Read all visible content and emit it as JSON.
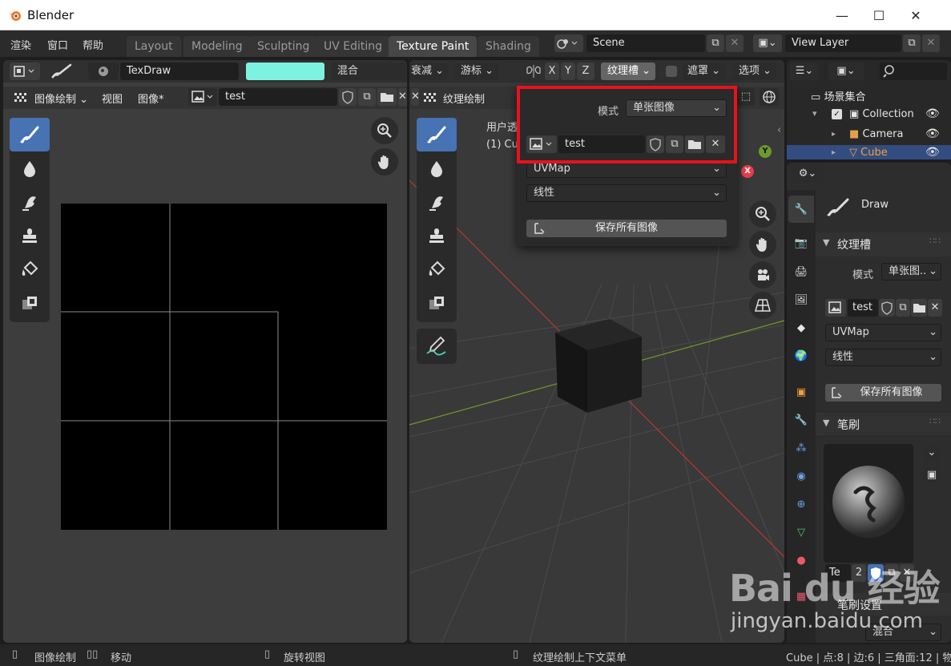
{
  "window": {
    "title": "Blender",
    "minimize": "—",
    "maximize": "☐",
    "close": "✕"
  },
  "menu": [
    "渲染",
    "窗口",
    "帮助"
  ],
  "workspace_tabs": [
    "Layout",
    "Modeling",
    "Sculpting",
    "UV Editing",
    "Texture Paint",
    "Shading"
  ],
  "active_tab": "Texture Paint",
  "scene": {
    "name": "Scene",
    "view_layer": "View Layer"
  },
  "left_editor": {
    "brush_name": "TexDraw",
    "blend_mode": "混合",
    "editor_mode": "图像绘制",
    "menu_view": "视图",
    "menu_image": "图像*",
    "image_name": "test",
    "brush_color": "#7ef2e0"
  },
  "viewport": {
    "falloff": "衰减",
    "cursor": "游标",
    "axis_x": "X",
    "axis_y": "Y",
    "axis_z": "Z",
    "texture_slots": "纹理槽",
    "mask": "遮罩",
    "options": "选项",
    "mode": "纹理绘制",
    "overlay_line1": "用户透",
    "overlay_line2": "(1) Cu",
    "gizmo_x": "X",
    "gizmo_y": "Y"
  },
  "popup": {
    "mode_label": "模式",
    "mode_value": "单张图像",
    "image_name": "test",
    "uvmap": "UVMap",
    "interpolation": "线性",
    "save_all": "保存所有图像"
  },
  "outliner": {
    "scene_collection": "场景集合",
    "items": [
      {
        "name": "Collection"
      },
      {
        "name": "Camera"
      },
      {
        "name": "Cube"
      }
    ]
  },
  "properties": {
    "tool_name": "Draw",
    "section_texture_slots": "纹理槽",
    "mode_label": "模式",
    "mode_value": "单张图..",
    "image_name": "test",
    "uvmap": "UVMap",
    "interpolation": "线性",
    "save_all": "保存所有图像",
    "section_brush": "笔刷",
    "brush_field": "Te",
    "brush_users": "2",
    "section_brush_settings": "笔刷设置",
    "blend": "混合"
  },
  "statusbar": {
    "left_action": "图像绘制",
    "middle_action": "移动",
    "rotate": "旋转视图",
    "context_menu": "纹理绘制上下文菜单",
    "stats": "Cube | 点:8 | 边:6 | 三角面:12 | 物"
  },
  "watermark": {
    "text": "Bai du 经验",
    "url": "jingyan.baidu.com"
  }
}
